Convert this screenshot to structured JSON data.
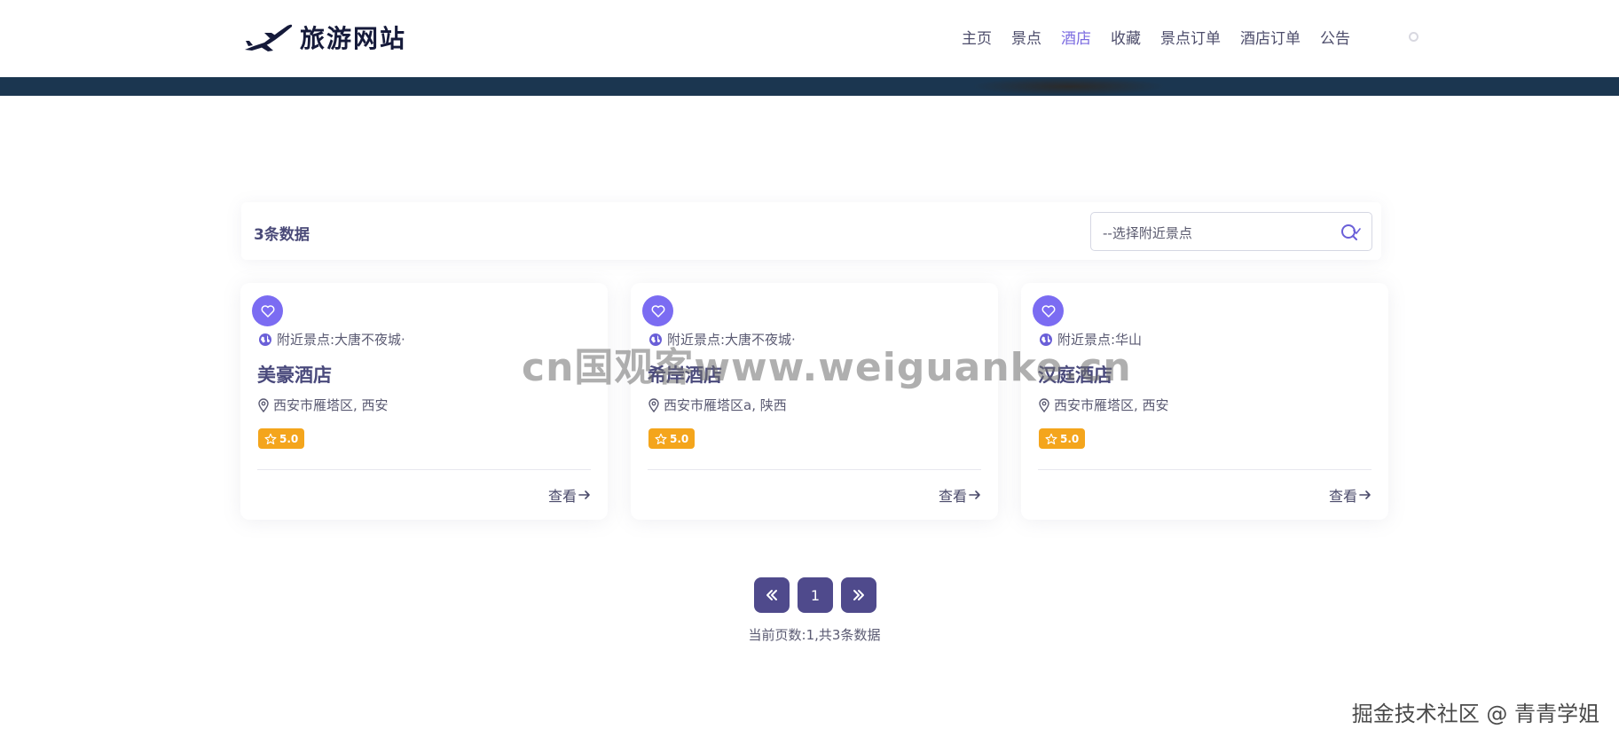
{
  "header": {
    "logo_text": "旅游网站",
    "nav": [
      {
        "label": "主页",
        "active": false
      },
      {
        "label": "景点",
        "active": false
      },
      {
        "label": "酒店",
        "active": true
      },
      {
        "label": "收藏",
        "active": false
      },
      {
        "label": "景点订单",
        "active": false
      },
      {
        "label": "酒店订单",
        "active": false
      },
      {
        "label": "公告",
        "active": false
      }
    ]
  },
  "toolbar": {
    "count_label": "3条数据",
    "select_placeholder": "--选择附近景点"
  },
  "cards": [
    {
      "nearby": "附近景点:大唐不夜城·",
      "name": "美豪酒店",
      "address": "西安市雁塔区, 西安",
      "rating": "5.0",
      "view_label": "查看"
    },
    {
      "nearby": "附近景点:大唐不夜城·",
      "name": "希岸酒店",
      "address": "西安市雁塔区a, 陕西",
      "rating": "5.0",
      "view_label": "查看"
    },
    {
      "nearby": "附近景点:华山",
      "name": "汉庭酒店",
      "address": "西安市雁塔区, 西安",
      "rating": "5.0",
      "view_label": "查看"
    }
  ],
  "pagination": {
    "current_page": "1",
    "info": "当前页数:1,共3条数据"
  },
  "watermarks": {
    "center": "cn国观客www.weiguanke.cn",
    "corner": "掘金技术社区 @ 青青学姐"
  },
  "colors": {
    "accent": "#7b6cf2",
    "nav_active": "#7b6be0",
    "pager": "#4f4a8c",
    "rating": "#f4a51c",
    "banner": "#1b3650"
  },
  "icons": {
    "logo": "airplane-icon",
    "favorite": "heart-icon",
    "nearby": "globe-icon",
    "address": "location-pin-icon",
    "rating": "star-icon",
    "view": "arrow-right-icon",
    "select": "search-icon",
    "prev": "double-chevron-left-icon",
    "next": "double-chevron-right-icon"
  }
}
